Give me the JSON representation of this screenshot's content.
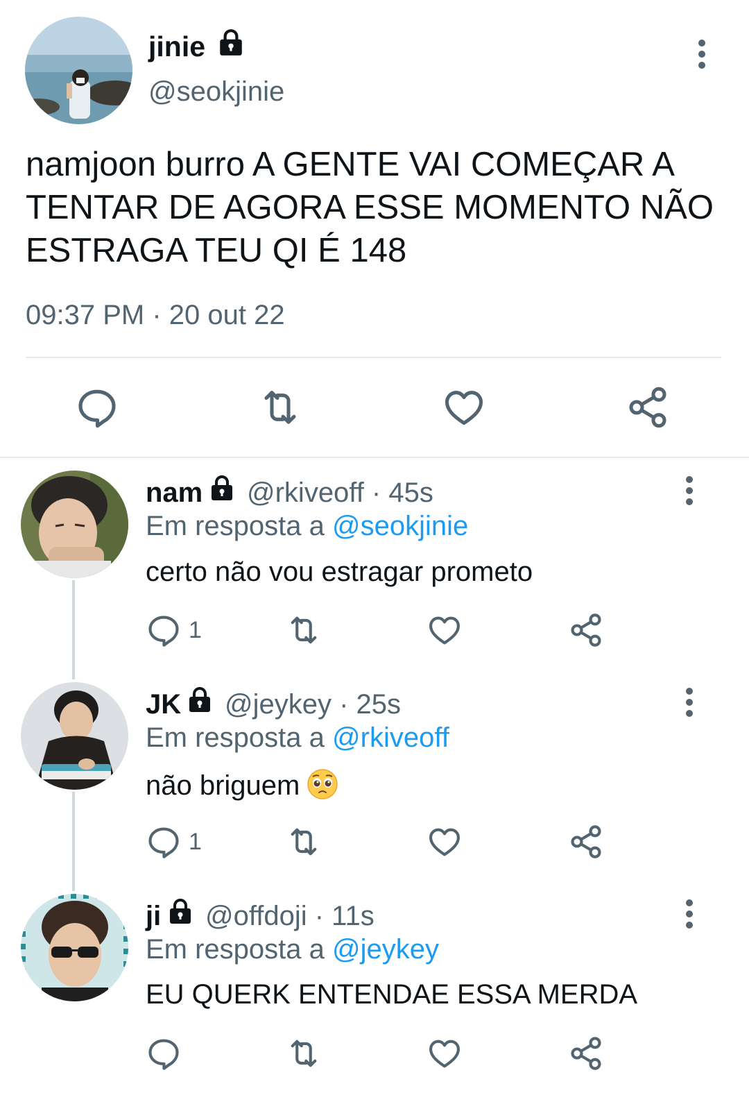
{
  "main_tweet": {
    "display_name": "jinie",
    "handle": "@seokjinie",
    "text": "namjoon burro A GENTE VAI COMEÇAR A TENTAR DE AGORA ESSE MOMENTO NÃO ESTRAGA TEU QI É 148",
    "timestamp": "09:37 PM · 20 out 22",
    "avatar_icon": "beach-photo-avatar",
    "actions": [
      "reply-icon",
      "retweet-icon",
      "like-icon",
      "share-icon"
    ]
  },
  "replies": [
    {
      "display_name": "nam",
      "handle_time": "@rkiveoff · 45s",
      "in_reply_prefix": "Em resposta a ",
      "in_reply_mention": "@seokjinie",
      "text": "certo não vou estragar prometo",
      "reply_count": "1",
      "avatar_icon": "selfie-avatar"
    },
    {
      "display_name": "JK",
      "handle_time": "@jeykey · 25s",
      "in_reply_prefix": "Em resposta a ",
      "in_reply_mention": "@rkiveoff",
      "text": "não briguem",
      "emoji": "pleading-face-emoji",
      "reply_count": "1",
      "avatar_icon": "drawing-avatar"
    },
    {
      "display_name": "ji",
      "handle_time": "@offdoji · 11s",
      "in_reply_prefix": "Em resposta a ",
      "in_reply_mention": "@jeykey",
      "text": "EU QUERK ENTENDAE ESSA MERDA",
      "reply_count": "",
      "avatar_icon": "sunglasses-avatar"
    }
  ],
  "colors": {
    "text": "#0f1419",
    "secondary": "#536471",
    "link": "#1d9bf0",
    "divider": "#e6e9eb",
    "thread_line": "#cfd9de"
  }
}
